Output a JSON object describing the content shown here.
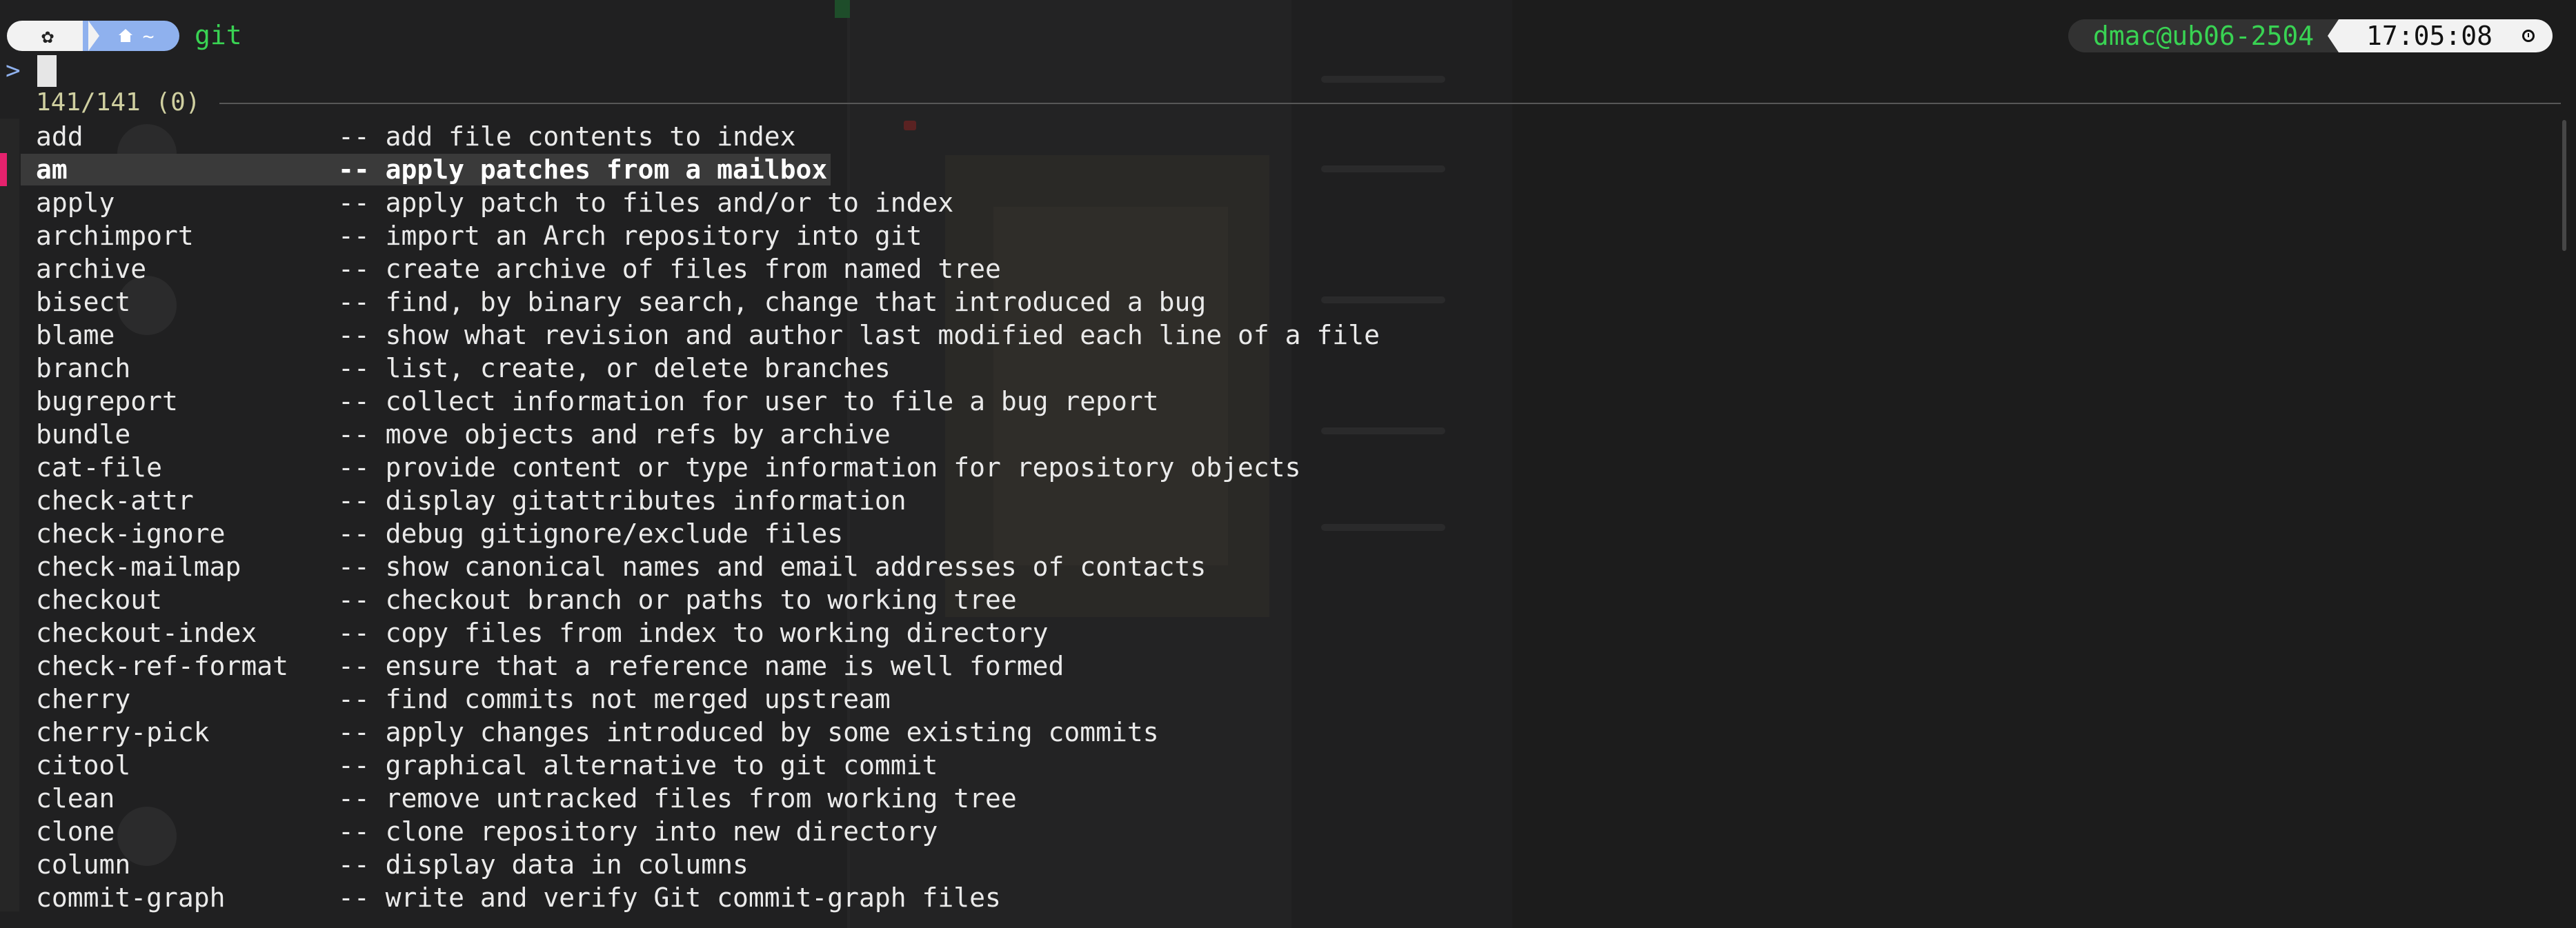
{
  "prompt": {
    "os_icon": "os-logo-icon",
    "home_icon": "home-icon",
    "directory": "~",
    "command": "git",
    "user_host": "dmac@ub06-2504",
    "time": "17:05:08",
    "clock_icon": "clock-icon"
  },
  "input": {
    "prompt_symbol": ">",
    "value": ""
  },
  "results": {
    "counter": "141/141 (0)"
  },
  "completions": [
    {
      "name": "add",
      "desc": "-- add file contents to index"
    },
    {
      "name": "am",
      "desc": "-- apply patches from a mailbox",
      "selected": true
    },
    {
      "name": "apply",
      "desc": "-- apply patch to files and/or to index"
    },
    {
      "name": "archimport",
      "desc": "-- import an Arch repository into git"
    },
    {
      "name": "archive",
      "desc": "-- create archive of files from named tree"
    },
    {
      "name": "bisect",
      "desc": "-- find, by binary search, change that introduced a bug"
    },
    {
      "name": "blame",
      "desc": "-- show what revision and author last modified each line of a file"
    },
    {
      "name": "branch",
      "desc": "-- list, create, or delete branches"
    },
    {
      "name": "bugreport",
      "desc": "-- collect information for user to file a bug report"
    },
    {
      "name": "bundle",
      "desc": "-- move objects and refs by archive"
    },
    {
      "name": "cat-file",
      "desc": "-- provide content or type information for repository objects"
    },
    {
      "name": "check-attr",
      "desc": "-- display gitattributes information"
    },
    {
      "name": "check-ignore",
      "desc": "-- debug gitignore/exclude files"
    },
    {
      "name": "check-mailmap",
      "desc": "-- show canonical names and email addresses of contacts"
    },
    {
      "name": "checkout",
      "desc": "-- checkout branch or paths to working tree"
    },
    {
      "name": "checkout-index",
      "desc": "-- copy files from index to working directory"
    },
    {
      "name": "check-ref-format",
      "desc": "-- ensure that a reference name is well formed"
    },
    {
      "name": "cherry",
      "desc": "-- find commits not merged upstream"
    },
    {
      "name": "cherry-pick",
      "desc": "-- apply changes introduced by some existing commits"
    },
    {
      "name": "citool",
      "desc": "-- graphical alternative to git commit"
    },
    {
      "name": "clean",
      "desc": "-- remove untracked files from working tree"
    },
    {
      "name": "clone",
      "desc": "-- clone repository into new directory"
    },
    {
      "name": "column",
      "desc": "-- display data in columns"
    },
    {
      "name": "commit-graph",
      "desc": "-- write and verify Git commit-graph files"
    }
  ],
  "colors": {
    "background": "#1c1c1c",
    "prompt_green": "#39d353",
    "dir_segment": "#8fb1ee",
    "selection_marker": "#e5226d",
    "selection_bg": "#3a3a3a",
    "counter_text": "#cfcfa0"
  }
}
